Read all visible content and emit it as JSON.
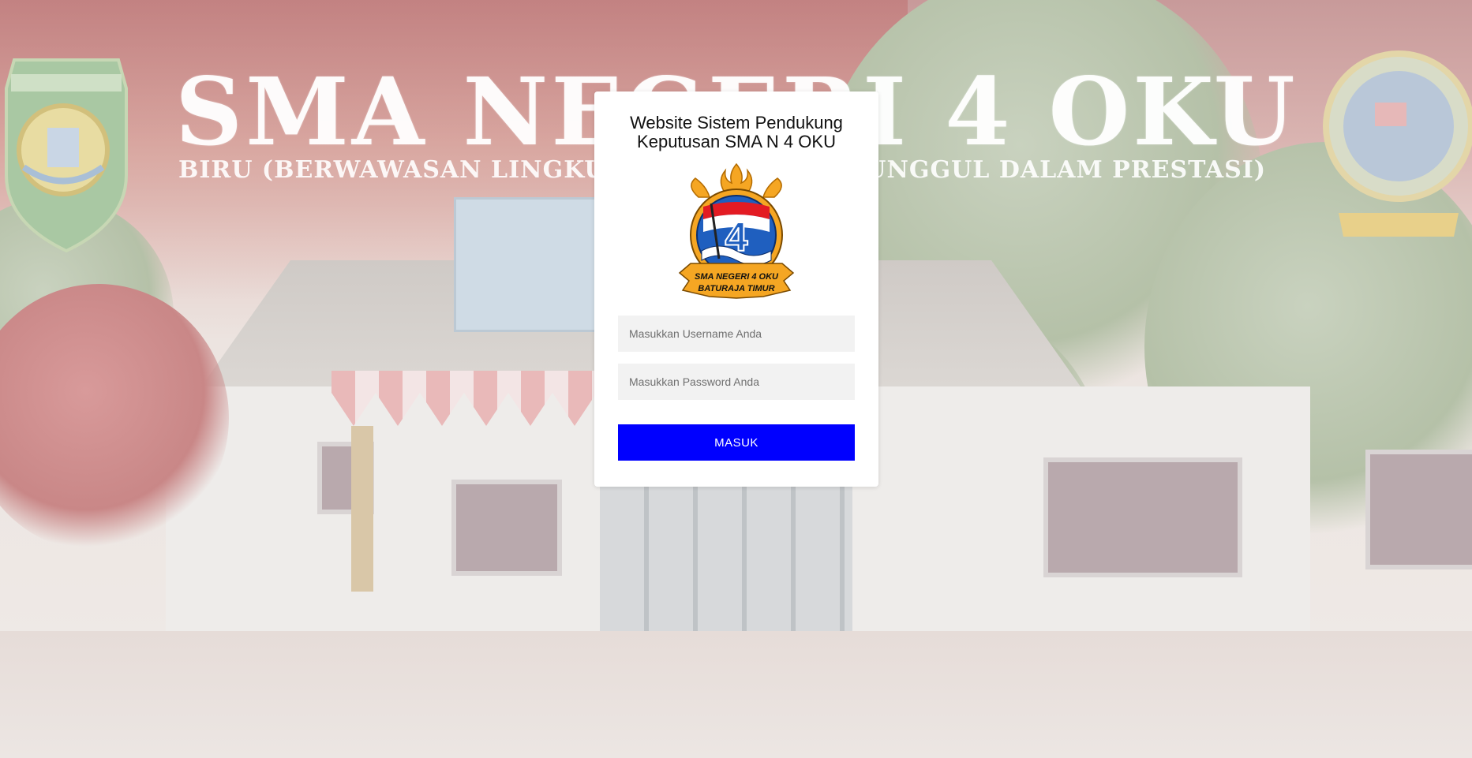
{
  "background": {
    "banner_title": "SMA NEGERI 4 OKU",
    "banner_subtitle": "BIRU (BERWAWASAN LINGKUNGAN, RELIGIUS, UNGGUL DALAM PRESTASI)"
  },
  "login": {
    "title": "Website Sistem Pendukung Keputusan SMA N 4 OKU",
    "logo_text_line1": "SMA NEGERI 4 OKU",
    "logo_text_line2": "BATURAJA TIMUR",
    "username_placeholder": "Masukkan Username Anda",
    "password_placeholder": "Masukkan Password Anda",
    "submit_label": "MASUK",
    "submit_color": "#0000ff"
  }
}
